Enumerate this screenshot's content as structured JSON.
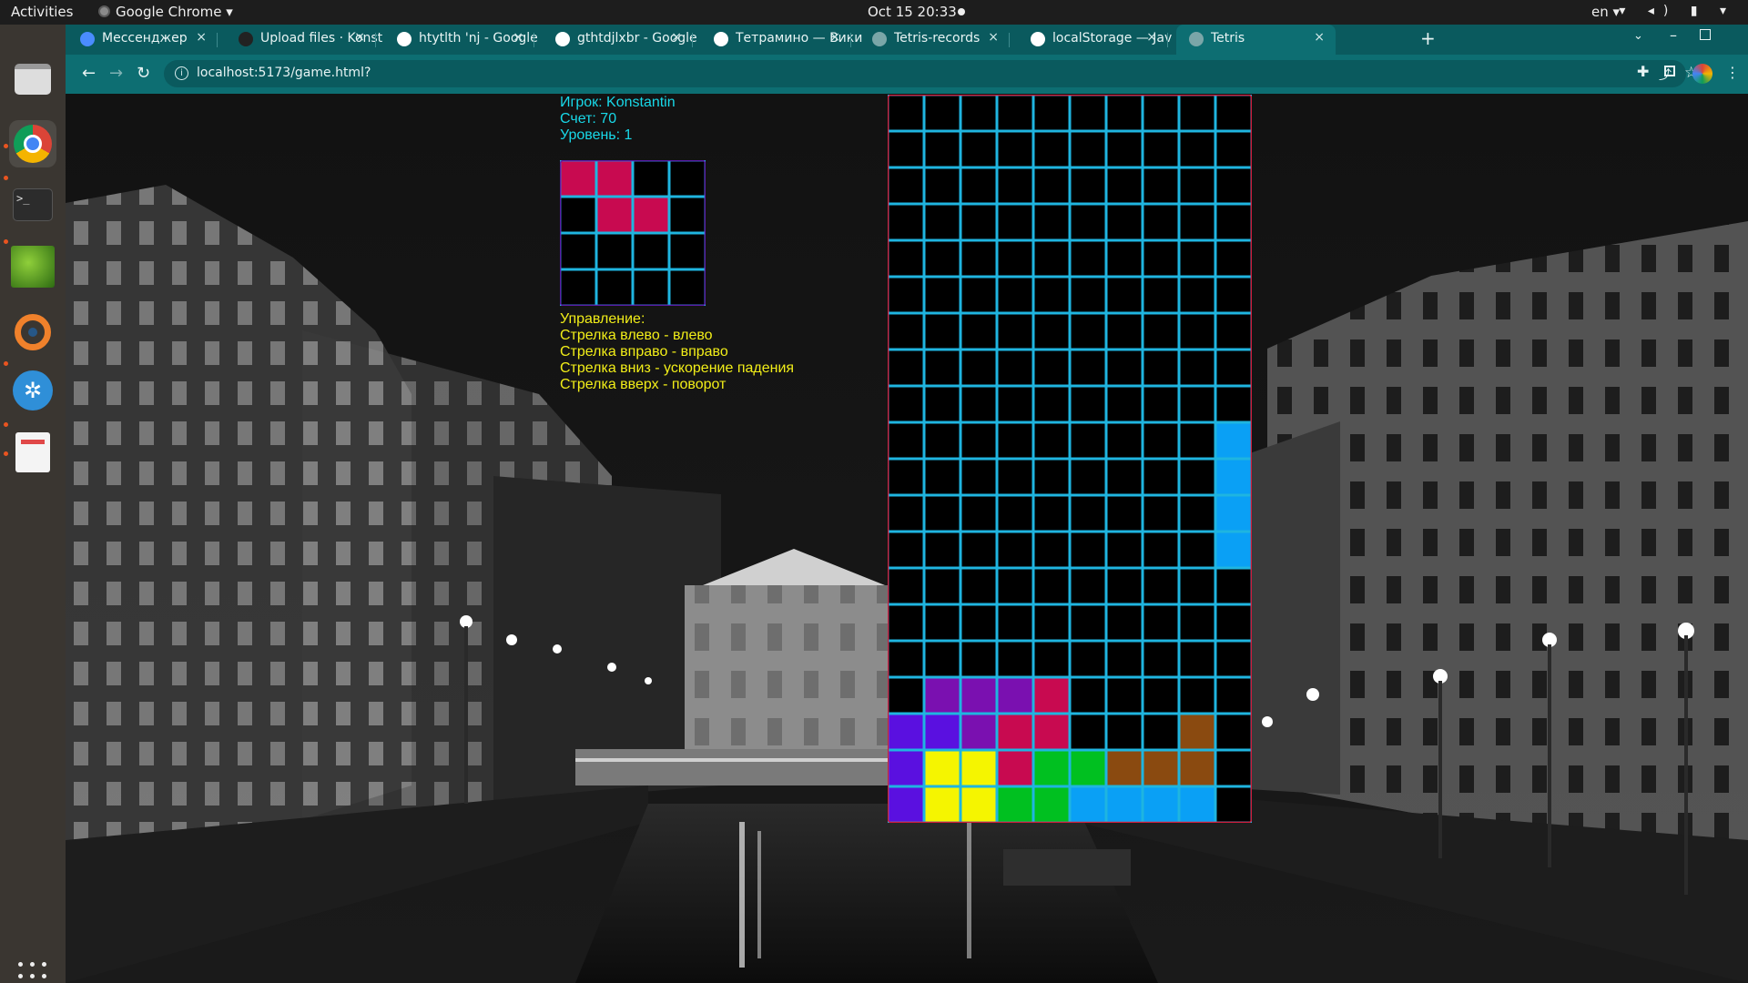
{
  "topbar": {
    "activities": "Activities",
    "app": "Google Chrome ▾",
    "clock": "Oct 15  20:33",
    "lang": "en ▾",
    "sys_icons": "▾ ◂) ▮ ▾"
  },
  "dock": {
    "items": [
      "files",
      "google-chrome",
      "terminal",
      "photos",
      "blender",
      "kde-app",
      "document-viewer"
    ]
  },
  "browser": {
    "tabs": [
      {
        "title": "Мессенджер",
        "favicon": "messenger-icon",
        "color": "#4a8cff"
      },
      {
        "title": "Upload files · Konst",
        "favicon": "github-icon",
        "color": "#222222"
      },
      {
        "title": "htytlth 'nj - Google",
        "favicon": "google-icon",
        "color": "#ffffff"
      },
      {
        "title": "gthtdjlxbr - Google",
        "favicon": "google-icon",
        "color": "#ffffff"
      },
      {
        "title": "Тетрамино — Вики",
        "favicon": "wikipedia-icon",
        "color": "#ffffff"
      },
      {
        "title": "Tetris-records",
        "favicon": "globe-icon",
        "color": "#7aa6a8"
      },
      {
        "title": "localStorage — Jav",
        "favicon": "mdn-icon",
        "color": "#ffffff"
      },
      {
        "title": "Tetris",
        "favicon": "globe-icon",
        "color": "#7aa6a8",
        "active": true
      }
    ],
    "close_glyph": "×",
    "newtab_glyph": "+",
    "url": "localhost:5173/game.html?"
  },
  "game": {
    "player": "Игрок: Konstantin",
    "score": "Счет: 70",
    "level": "Уровень: 1",
    "controls_title": "Управление:",
    "controls": [
      "Стрелка влево - влево",
      "Стрелка вправо - вправо",
      "Стрелка вниз - ускорение падения",
      "Стрелка вверх - поворот"
    ],
    "colors": {
      "grid": "#1fb5e0",
      "board_border": "#d01c3c",
      "preview_border": "#5a1aa8",
      "cell_bg": "#000000",
      "P": "#7a10b0",
      "B": "#5a10e0",
      "R": "#c80a50",
      "Y": "#f5f500",
      "G": "#00c020",
      "O": "#8a4a10",
      "C": "#0aa0f5"
    },
    "next_piece": [
      "RR..",
      ".RR.",
      "....",
      "...."
    ],
    "board": [
      "..........",
      "..........",
      "..........",
      "..........",
      "..........",
      "..........",
      "..........",
      "..........",
      ".........C",
      ".........C",
      ".........C",
      ".........C",
      "..........",
      "..........",
      "..........",
      ".PPPR.....",
      "BBPRR...O.",
      "BYYRGGOOO.",
      "BYYGGCCCC."
    ]
  }
}
